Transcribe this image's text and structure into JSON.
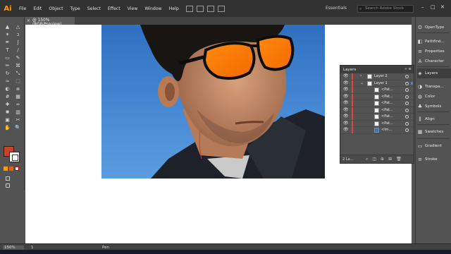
{
  "app": {
    "logo": "Ai"
  },
  "menubar": {
    "items": [
      "File",
      "Edit",
      "Object",
      "Type",
      "Select",
      "Effect",
      "View",
      "Window",
      "Help"
    ],
    "workspace": "Essentials",
    "search_placeholder": "Search Adobe Stock",
    "window_controls": {
      "minimize": "–",
      "restore": "□",
      "close": "✕"
    }
  },
  "document": {
    "tab_title": "@ 150% (RGB/Preview)",
    "close_glyph": "×"
  },
  "tools": {
    "icons": [
      "selection-icon",
      "direct-selection-icon",
      "magic-wand-icon",
      "lasso-icon",
      "pen-icon",
      "curvature-icon",
      "type-icon",
      "line-icon",
      "rectangle-icon",
      "paintbrush-icon",
      "pencil-icon",
      "shaper-icon",
      "rotate-icon",
      "scale-icon",
      "width-icon",
      "free-transform-icon",
      "shape-builder-icon",
      "perspective-icon",
      "mesh-icon",
      "gradient-icon",
      "eyedropper-icon",
      "blend-icon",
      "symbol-sprayer-icon",
      "graph-icon",
      "artboard-icon",
      "slice-icon",
      "hand-icon",
      "zoom-icon"
    ],
    "glyphs": [
      "▲",
      "△",
      "✶",
      "ↄ",
      "✒",
      "∫",
      "T",
      "/",
      "▭",
      "✎",
      "✏",
      "⌘",
      "↻",
      "⤡",
      "≈",
      "⬚",
      "◐",
      "⧈",
      "#",
      "▦",
      "✚",
      "∞",
      "✺",
      "▥",
      "▣",
      "✂",
      "✋",
      "🔍"
    ],
    "fill_color": "#c4452c",
    "stroke_color": "#ffffff"
  },
  "dock": {
    "items": [
      {
        "label": "OpenType",
        "icon": "opentype-icon",
        "glyph": "O"
      },
      {
        "label": "Pathfind...",
        "icon": "pathfinder-icon",
        "glyph": "◧"
      },
      {
        "label": "Properties",
        "icon": "properties-icon",
        "glyph": "≡"
      },
      {
        "label": "Character",
        "icon": "character-icon",
        "glyph": "A"
      },
      {
        "label": "Layers",
        "icon": "layers-icon",
        "glyph": "◈"
      },
      {
        "label": "Transpa...",
        "icon": "transparency-icon",
        "glyph": "◑"
      },
      {
        "label": "Color",
        "icon": "color-icon",
        "glyph": "◍"
      },
      {
        "label": "Symbols",
        "icon": "symbols-icon",
        "glyph": "♣"
      },
      {
        "label": "Align",
        "icon": "align-icon",
        "glyph": "⫼"
      },
      {
        "label": "Swatches",
        "icon": "swatches-icon",
        "glyph": "▦"
      },
      {
        "label": "Gradient",
        "icon": "gradient-panel-icon",
        "glyph": "▭"
      },
      {
        "label": "Stroke",
        "icon": "stroke-icon",
        "glyph": "≡"
      }
    ]
  },
  "layers_panel": {
    "title": "Layers",
    "controls": "» ≡",
    "rows": [
      {
        "label": "Layer 2",
        "expanded": false,
        "indent": 0
      },
      {
        "label": "Layer 1",
        "expanded": true,
        "indent": 0
      },
      {
        "label": "<Pat...",
        "indent": 1
      },
      {
        "label": "<Pat...",
        "indent": 1
      },
      {
        "label": "<Pat...",
        "indent": 1
      },
      {
        "label": "<Pat...",
        "indent": 1
      },
      {
        "label": "<Pat...",
        "indent": 1
      },
      {
        "label": "<Pat...",
        "indent": 1
      },
      {
        "label": "<Im...",
        "indent": 1
      }
    ],
    "footer_count": "2 La...",
    "footer_icons": [
      "locate-icon",
      "clipping-mask-icon",
      "sublayer-icon",
      "new-layer-icon",
      "trash-icon"
    ],
    "footer_glyphs": [
      "⌕",
      "◫",
      "⊕",
      "⊞",
      "🗑"
    ]
  },
  "statusbar": {
    "zoom": "150%",
    "page": "1",
    "mode": "Pen"
  }
}
